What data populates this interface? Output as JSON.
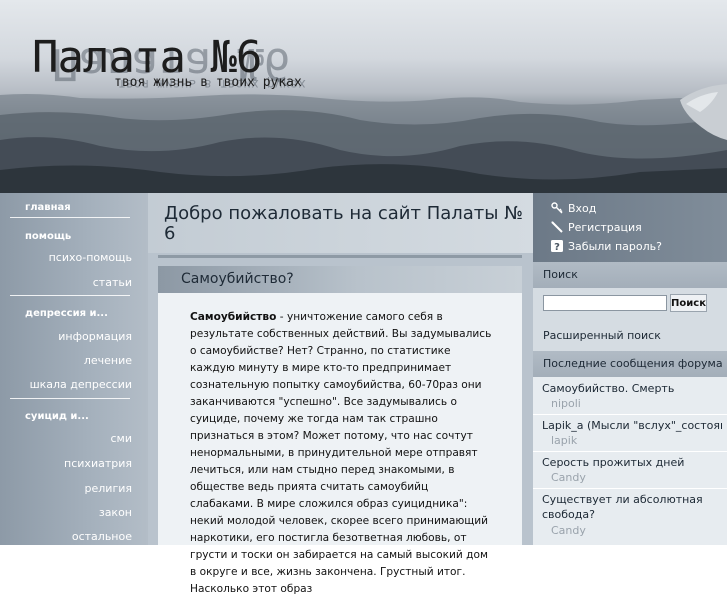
{
  "header": {
    "site_title": "Палата №6",
    "site_slogan": "твоя жизнь в твоих руках"
  },
  "left_nav": {
    "sections": [
      {
        "header": "главная",
        "items": []
      },
      {
        "header": "помощь",
        "items": [
          "психо-помощь",
          "статьи"
        ]
      },
      {
        "header": "депрессия и...",
        "items": [
          "информация",
          "лечение",
          "шкала депрессии"
        ]
      },
      {
        "header": "суицид и...",
        "items": [
          "сми",
          "психиатрия",
          "религия",
          "закон",
          "остальное"
        ]
      }
    ]
  },
  "main": {
    "page_title": "Добро пожаловать на сайт Палаты № 6",
    "article": {
      "title": "Самоубийство?",
      "body_bold": "Самоубийство",
      "body_text": " - уничтожение самого себя в результате собственных действий.            Вы задумывались о самоубийстве? Нет? Странно, по статистике каждую минуту в мире кто-то предпринимает сознательную попытку самоубийства,   60-70раз они заканчиваются \"успешно\". Все задумывались о суициде, почему же тогда нам так страшно признаться в этом? Может потому, что нас сочтут ненормальными, в принудительной мере отправят лечиться, или нам стыдно перед знакомыми, в обществе ведь прията считать самоубийц слабаками.    В мире сложился образ  суицидника\": некий молодой человек, скорее всего принимающий наркотики, его постигла безответная любовь, от грусти и тоски он забирается на самый высокий дом в округе и все, жизнь закончена. Грустный итог. Насколько этот образ"
    }
  },
  "user_links": {
    "login": "Вход",
    "register": "Регистрация",
    "forgot": "Забыли пароль?"
  },
  "search": {
    "header": "Поиск",
    "value": "",
    "button_label": "Поиск",
    "advanced": "Расширенный поиск"
  },
  "forum": {
    "header": "Последние сообщения форума",
    "topics": [
      {
        "title": "Самоубийство. Смерть",
        "user": "nipoli"
      },
      {
        "title": "Lapik_a (Мысли \"вслух\"_состоян...",
        "user": "lapik"
      },
      {
        "title": "Серость прожитых дней",
        "user": "Candy"
      },
      {
        "title": "Существует ли абсолютная свобода?",
        "user": "Candy"
      }
    ]
  }
}
